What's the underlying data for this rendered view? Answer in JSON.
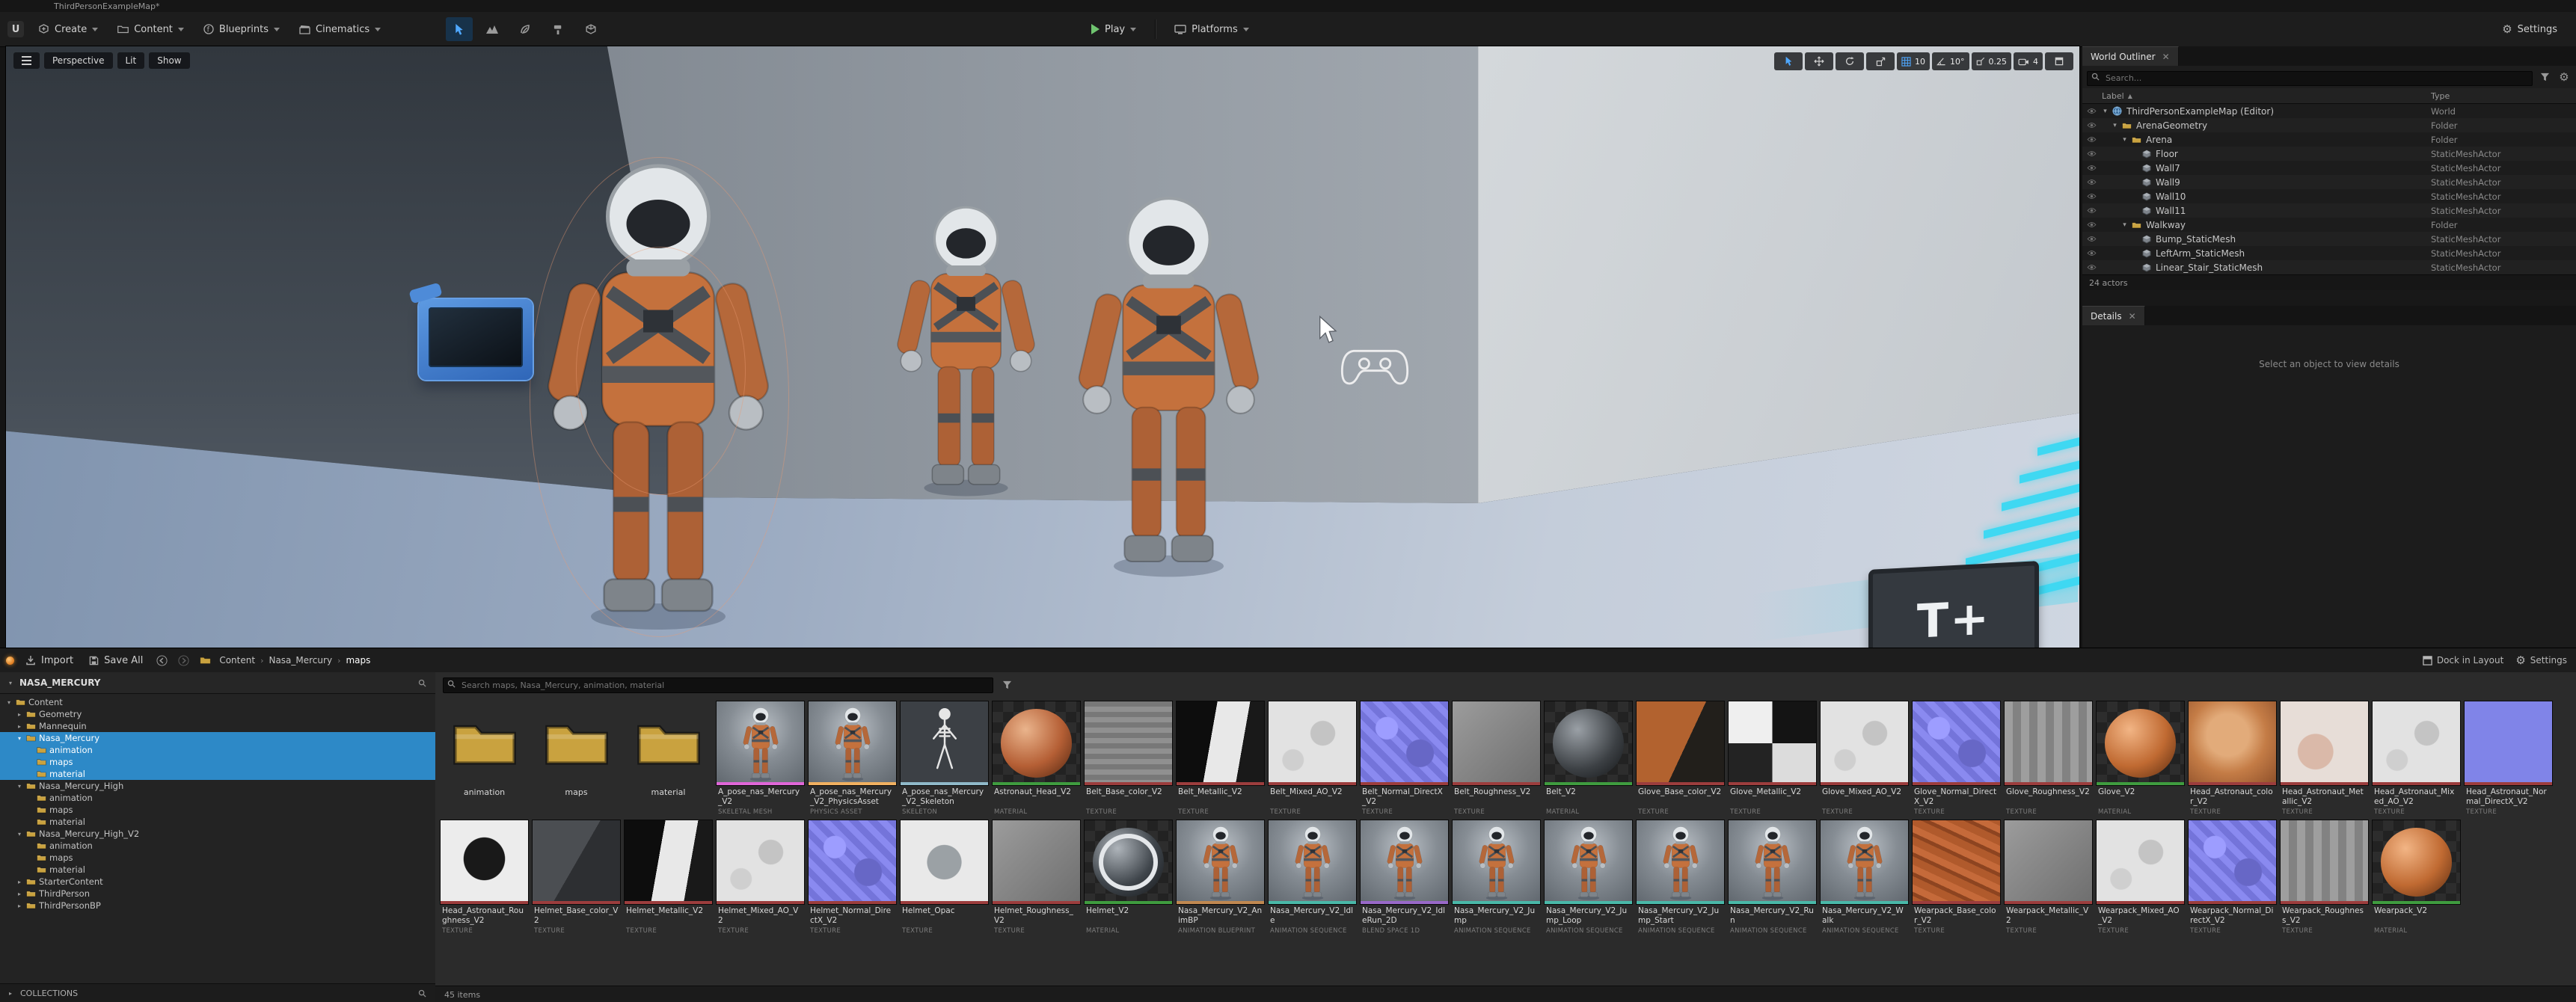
{
  "window": {
    "title": "ThirdPersonExampleMap*"
  },
  "colors": {
    "selection_blue": "#2d89c7",
    "play_green": "#6fc46f",
    "folder_tan": "#c9a23f",
    "viewport_cyan": "#3fd8f2",
    "mode_active_blue": "#4fa8ff"
  },
  "icons": {
    "settings": "gear-icon",
    "search": "magnifier-icon",
    "play": "play-triangle-icon",
    "folder": "folder-icon"
  },
  "toolbar": {
    "create": "Create",
    "content": "Content",
    "blueprints": "Blueprints",
    "cinematics": "Cinematics",
    "play": "Play",
    "platforms": "Platforms",
    "settings": "Settings"
  },
  "viewport": {
    "perspective": "Perspective",
    "lit": "Lit",
    "show": "Show",
    "grid_snap": "10",
    "rotation_snap": "10°",
    "scale_snap": "0.25",
    "camera_speed": "4",
    "sign_text": "T+"
  },
  "outliner": {
    "tab": "World Outliner",
    "search_placeholder": "Search...",
    "columns": {
      "label": "Label",
      "type": "Type"
    },
    "status": "24 actors",
    "rows": [
      {
        "label": "ThirdPersonExampleMap (Editor)",
        "type": "World",
        "depth": 0,
        "icon": "world",
        "expanded": true
      },
      {
        "label": "ArenaGeometry",
        "type": "Folder",
        "depth": 1,
        "icon": "folder",
        "expanded": true
      },
      {
        "label": "Arena",
        "type": "Folder",
        "depth": 2,
        "icon": "folder",
        "expanded": true
      },
      {
        "label": "Floor",
        "type": "StaticMeshActor",
        "depth": 3,
        "icon": "mesh"
      },
      {
        "label": "Wall7",
        "type": "StaticMeshActor",
        "depth": 3,
        "icon": "mesh"
      },
      {
        "label": "Wall9",
        "type": "StaticMeshActor",
        "depth": 3,
        "icon": "mesh"
      },
      {
        "label": "Wall10",
        "type": "StaticMeshActor",
        "depth": 3,
        "icon": "mesh"
      },
      {
        "label": "Wall11",
        "type": "StaticMeshActor",
        "depth": 3,
        "icon": "mesh"
      },
      {
        "label": "Walkway",
        "type": "Folder",
        "depth": 2,
        "icon": "folder",
        "expanded": true
      },
      {
        "label": "Bump_StaticMesh",
        "type": "StaticMeshActor",
        "depth": 3,
        "icon": "mesh"
      },
      {
        "label": "LeftArm_StaticMesh",
        "type": "StaticMeshActor",
        "depth": 3,
        "icon": "mesh"
      },
      {
        "label": "Linear_Stair_StaticMesh",
        "type": "StaticMeshActor",
        "depth": 3,
        "icon": "mesh"
      }
    ]
  },
  "details": {
    "tab": "Details",
    "empty_text": "Select an object to view details"
  },
  "content_browser": {
    "import": "Import",
    "save_all": "Save All",
    "breadcrumb": [
      "Content",
      "Nasa_Mercury",
      "maps"
    ],
    "dock": "Dock in Layout",
    "settings": "Settings",
    "sources_title": "NASA_MERCURY",
    "search_placeholder": "Search maps, Nasa_Mercury, animation, material",
    "collections": "COLLECTIONS",
    "status": "45 items",
    "type_colors": {
      "TEXTURE": "#9c3d3d",
      "MATERIAL": "#3f9c3f",
      "SKELETAL MESH": "#e066d8",
      "PHYSICS ASSET": "#f0b060",
      "SKELETON": "#8fb8c8",
      "ANIMATION SEQUENCE": "#49b8a8",
      "ANIMATION BLUEPRINT": "#c08850",
      "BLEND SPACE 1D": "#9868c8"
    },
    "tree": [
      {
        "label": "Content",
        "depth": 0,
        "expanded": true
      },
      {
        "label": "Geometry",
        "depth": 1,
        "expanded": false
      },
      {
        "label": "Mannequin",
        "depth": 1,
        "expanded": false
      },
      {
        "label": "Nasa_Mercury",
        "depth": 1,
        "expanded": true,
        "selected": true
      },
      {
        "label": "animation",
        "depth": 2,
        "selected": true
      },
      {
        "label": "maps",
        "depth": 2,
        "selected": true
      },
      {
        "label": "material",
        "depth": 2,
        "selected": true
      },
      {
        "label": "Nasa_Mercury_High",
        "depth": 1,
        "expanded": true
      },
      {
        "label": "animation",
        "depth": 2
      },
      {
        "label": "maps",
        "depth": 2
      },
      {
        "label": "material",
        "depth": 2
      },
      {
        "label": "Nasa_Mercury_High_V2",
        "depth": 1,
        "expanded": true
      },
      {
        "label": "animation",
        "depth": 2
      },
      {
        "label": "maps",
        "depth": 2
      },
      {
        "label": "material",
        "depth": 2
      },
      {
        "label": "StarterContent",
        "depth": 1,
        "expanded": false
      },
      {
        "label": "ThirdPerson",
        "depth": 1,
        "expanded": false
      },
      {
        "label": "ThirdPersonBP",
        "depth": 1,
        "expanded": false
      }
    ],
    "assets": [
      {
        "kind": "folder",
        "name": "animation"
      },
      {
        "kind": "folder",
        "name": "maps"
      },
      {
        "kind": "folder",
        "name": "material"
      },
      {
        "kind": "asset",
        "name": "A_pose_nas_Mercury_V2",
        "type": "SKELETAL MESH",
        "thumb": "astro"
      },
      {
        "kind": "asset",
        "name": "A_pose_nas_Mercury_V2_PhysicsAsset",
        "type": "PHYSICS ASSET",
        "thumb": "astro"
      },
      {
        "kind": "asset",
        "name": "A_pose_nas_Mercury_V2_Skeleton",
        "type": "SKELETON",
        "thumb": "skel"
      },
      {
        "kind": "asset",
        "name": "Astronaut_Head_V2",
        "type": "MATERIAL",
        "thumb": "sph-head"
      },
      {
        "kind": "asset",
        "name": "Belt_Base_color_V2",
        "type": "TEXTURE",
        "thumb": "tex-grayfabric"
      },
      {
        "kind": "asset",
        "name": "Belt_Metallic_V2",
        "type": "TEXTURE",
        "thumb": "tex-bw"
      },
      {
        "kind": "asset",
        "name": "Belt_Mixed_AO_V2",
        "type": "TEXTURE",
        "thumb": "tex-white"
      },
      {
        "kind": "asset",
        "name": "Belt_Normal_DirectX_V2",
        "type": "TEXTURE",
        "thumb": "tex-normal"
      },
      {
        "kind": "asset",
        "name": "Belt_Roughness_V2",
        "type": "TEXTURE",
        "thumb": "tex-gray"
      },
      {
        "kind": "asset",
        "name": "Belt_V2",
        "type": "MATERIAL",
        "thumb": "sph-dark"
      },
      {
        "kind": "asset",
        "name": "Glove_Base_color_V2",
        "type": "TEXTURE",
        "thumb": "tex-orangedark"
      },
      {
        "kind": "asset",
        "name": "Glove_Metallic_V2",
        "type": "TEXTURE",
        "thumb": "tex-bw2"
      },
      {
        "kind": "asset",
        "name": "Glove_Mixed_AO_V2",
        "type": "TEXTURE",
        "thumb": "tex-white"
      },
      {
        "kind": "asset",
        "name": "Glove_Normal_DirectX_V2",
        "type": "TEXTURE",
        "thumb": "tex-normal"
      },
      {
        "kind": "asset",
        "name": "Glove_Roughness_V2",
        "type": "TEXTURE",
        "thumb": "tex-gray2"
      },
      {
        "kind": "asset",
        "name": "Glove_V2",
        "type": "MATERIAL",
        "thumb": "sph-orange"
      },
      {
        "kind": "asset",
        "name": "Head_Astronaut_color_V2",
        "type": "TEXTURE",
        "thumb": "tex-face"
      },
      {
        "kind": "asset",
        "name": "Head_Astronaut_Metallic_V2",
        "type": "TEXTURE",
        "thumb": "tex-palepink"
      },
      {
        "kind": "asset",
        "name": "Head_Astronaut_Mixed_AO_V2",
        "type": "TEXTURE",
        "thumb": "tex-white"
      },
      {
        "kind": "asset",
        "name": "Head_Astronaut_Normal_DirectX_V2",
        "type": "TEXTURE",
        "thumb": "tex-blue"
      },
      {
        "kind": "asset",
        "name": "Head_Astronaut_Roughness_V2",
        "type": "TEXTURE",
        "thumb": "tex-bwface"
      },
      {
        "kind": "asset",
        "name": "Helmet_Base_color_V2",
        "type": "TEXTURE",
        "thumb": "tex-darkgray"
      },
      {
        "kind": "asset",
        "name": "Helmet_Metallic_V2",
        "type": "TEXTURE",
        "thumb": "tex-bw"
      },
      {
        "kind": "asset",
        "name": "Helmet_Mixed_AO_V2",
        "type": "TEXTURE",
        "thumb": "tex-white"
      },
      {
        "kind": "asset",
        "name": "Helmet_Normal_DirectX_V2",
        "type": "TEXTURE",
        "thumb": "tex-normal"
      },
      {
        "kind": "asset",
        "name": "Helmet_Opac",
        "type": "TEXTURE",
        "thumb": "tex-opac"
      },
      {
        "kind": "asset",
        "name": "Helmet_Roughness_V2",
        "type": "TEXTURE",
        "thumb": "tex-gray"
      },
      {
        "kind": "asset",
        "name": "Helmet_V2",
        "type": "MATERIAL",
        "thumb": "sph-helmet"
      },
      {
        "kind": "asset",
        "name": "Nasa_Mercury_V2_AnimBP",
        "type": "ANIMATION BLUEPRINT",
        "thumb": "astro"
      },
      {
        "kind": "asset",
        "name": "Nasa_Mercury_V2_Idle",
        "type": "ANIMATION SEQUENCE",
        "thumb": "astro"
      },
      {
        "kind": "asset",
        "name": "Nasa_Mercury_V2_IdleRun_2D",
        "type": "BLEND SPACE 1D",
        "thumb": "astro"
      },
      {
        "kind": "asset",
        "name": "Nasa_Mercury_V2_Jump",
        "type": "ANIMATION SEQUENCE",
        "thumb": "astro"
      },
      {
        "kind": "asset",
        "name": "Nasa_Mercury_V2_Jump_Loop",
        "type": "ANIMATION SEQUENCE",
        "thumb": "astro"
      },
      {
        "kind": "asset",
        "name": "Nasa_Mercury_V2_Jump_Start",
        "type": "ANIMATION SEQUENCE",
        "thumb": "astro"
      },
      {
        "kind": "asset",
        "name": "Nasa_Mercury_V2_Run",
        "type": "ANIMATION SEQUENCE",
        "thumb": "astro"
      },
      {
        "kind": "asset",
        "name": "Nasa_Mercury_V2_Walk",
        "type": "ANIMATION SEQUENCE",
        "thumb": "astro"
      },
      {
        "kind": "asset",
        "name": "Wearpack_Base_color_V2",
        "type": "TEXTURE",
        "thumb": "tex-rust"
      },
      {
        "kind": "asset",
        "name": "Wearpack_Metallic_V2",
        "type": "TEXTURE",
        "thumb": "tex-gray"
      },
      {
        "kind": "asset",
        "name": "Wearpack_Mixed_AO_V2",
        "type": "TEXTURE",
        "thumb": "tex-white"
      },
      {
        "kind": "asset",
        "name": "Wearpack_Normal_DirectX_V2",
        "type": "TEXTURE",
        "thumb": "tex-normal"
      },
      {
        "kind": "asset",
        "name": "Wearpack_Roughness_V2",
        "type": "TEXTURE",
        "thumb": "tex-gray2"
      },
      {
        "kind": "asset",
        "name": "Wearpack_V2",
        "type": "MATERIAL",
        "thumb": "sph-orange"
      }
    ]
  }
}
